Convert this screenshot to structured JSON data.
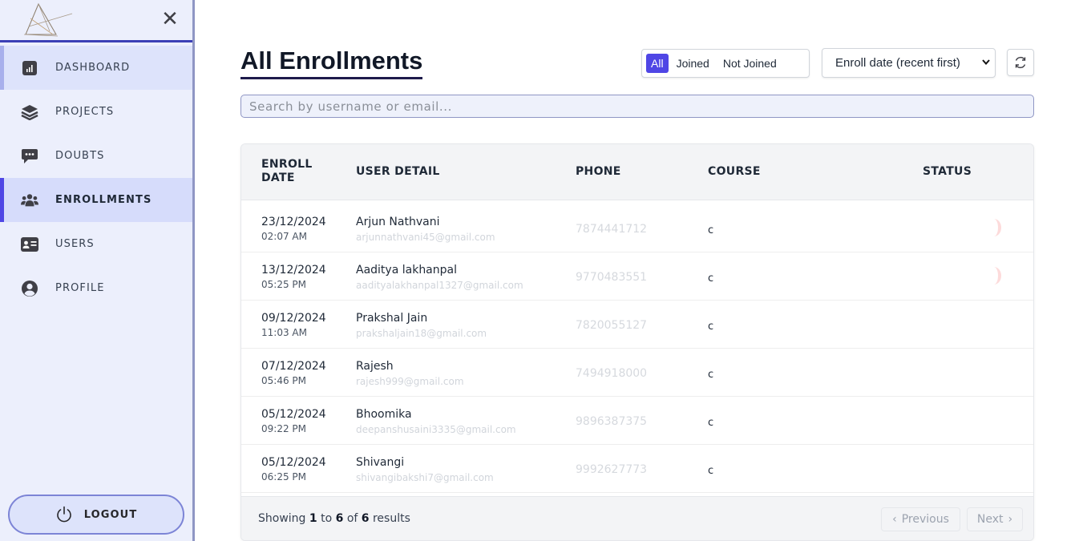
{
  "colors": {
    "accent": "#4f46e5",
    "sidebar_bg": "#eceffc",
    "active_bg": "#d6dcfb"
  },
  "sidebar": {
    "items": [
      {
        "label": "DASHBOARD",
        "icon": "chart-icon"
      },
      {
        "label": "PROJECTS",
        "icon": "layers-icon"
      },
      {
        "label": "DOUBTS",
        "icon": "chat-icon"
      },
      {
        "label": "ENROLLMENTS",
        "icon": "users-group-icon"
      },
      {
        "label": "USERS",
        "icon": "id-card-icon"
      },
      {
        "label": "PROFILE",
        "icon": "user-circle-icon"
      }
    ],
    "logout_label": "LOGOUT"
  },
  "header": {
    "title": "All Enrollments",
    "filters": [
      "All",
      "Joined",
      "Not Joined"
    ],
    "active_filter": "All",
    "sort_value": "Enroll date (recent first)"
  },
  "search": {
    "placeholder": "Search by username or email..."
  },
  "table": {
    "headers": {
      "enroll_line1": "ENROLL",
      "enroll_line2": "DATE",
      "user": "USER DETAIL",
      "phone": "PHONE",
      "course": "COURSE",
      "status": "STATUS"
    },
    "rows": [
      {
        "date": "23/12/2024",
        "time": "02:07 AM",
        "name": "Arjun Nathvani",
        "email": "arjunnathvani45@gmail.com",
        "phone": "7874441712",
        "course": "c"
      },
      {
        "date": "13/12/2024",
        "time": "05:25 PM",
        "name": "Aaditya lakhanpal",
        "email": "aadityalakhanpal1327@gmail.com",
        "phone": "9770483551",
        "course": "c"
      },
      {
        "date": "09/12/2024",
        "time": "11:03 AM",
        "name": "Prakshal Jain",
        "email": "prakshaljain18@gmail.com",
        "phone": "7820055127",
        "course": "c"
      },
      {
        "date": "07/12/2024",
        "time": "05:46 PM",
        "name": "Rajesh",
        "email": "rajesh999@gmail.com",
        "phone": "7494918000",
        "course": "c"
      },
      {
        "date": "05/12/2024",
        "time": "09:22 PM",
        "name": "Bhoomika",
        "email": "deepanshusaini3335@gmail.com",
        "phone": "9896387375",
        "course": "c"
      },
      {
        "date": "05/12/2024",
        "time": "06:25 PM",
        "name": "Shivangi",
        "email": "shivangibakshi7@gmail.com",
        "phone": "9992627773",
        "course": "c"
      }
    ]
  },
  "footer": {
    "showing_prefix": "Showing",
    "from": "1",
    "to_word": "to",
    "to": "6",
    "of_word": "of",
    "total": "6",
    "suffix": "results",
    "prev_label": "Previous",
    "next_label": "Next"
  }
}
